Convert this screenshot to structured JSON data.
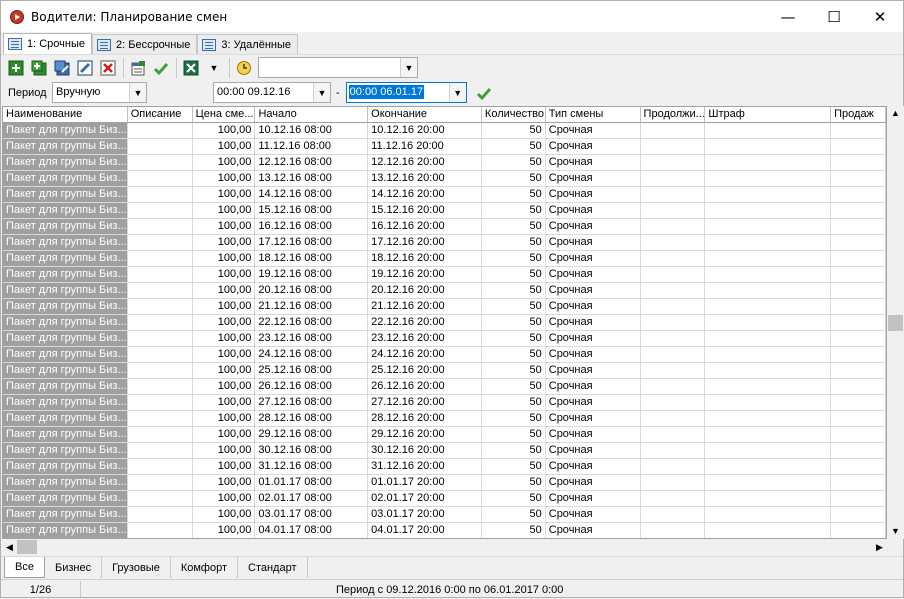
{
  "window": {
    "title": "Водители: Планирование смен",
    "minimize": "—",
    "maximize": "☐",
    "close": "✕"
  },
  "tabs": [
    {
      "label": "1: Срочные"
    },
    {
      "label": "2: Бессрочные"
    },
    {
      "label": "3: Удалённые"
    }
  ],
  "toolbar": {
    "combo_value": ""
  },
  "filter": {
    "period_label": "Период",
    "period_value": "Вручную",
    "date_from": "00:00 09.12.16",
    "dash": "-",
    "date_to": "00:00 06.01.17"
  },
  "grid": {
    "columns": [
      "Наименование",
      "Описание",
      "Цена сме...",
      "Начало",
      "Окончание",
      "Количество",
      "Тип смены",
      "Продолжи...",
      "Штраф",
      "Продаж"
    ],
    "rows": [
      [
        "Пакет для группы Биз...",
        "",
        "100,00",
        "10.12.16 08:00",
        "10.12.16 20:00",
        "50",
        "Срочная",
        "",
        "",
        ""
      ],
      [
        "Пакет для группы Биз...",
        "",
        "100,00",
        "11.12.16 08:00",
        "11.12.16 20:00",
        "50",
        "Срочная",
        "",
        "",
        ""
      ],
      [
        "Пакет для группы Биз...",
        "",
        "100,00",
        "12.12.16 08:00",
        "12.12.16 20:00",
        "50",
        "Срочная",
        "",
        "",
        ""
      ],
      [
        "Пакет для группы Биз...",
        "",
        "100,00",
        "13.12.16 08:00",
        "13.12.16 20:00",
        "50",
        "Срочная",
        "",
        "",
        ""
      ],
      [
        "Пакет для группы Биз...",
        "",
        "100,00",
        "14.12.16 08:00",
        "14.12.16 20:00",
        "50",
        "Срочная",
        "",
        "",
        ""
      ],
      [
        "Пакет для группы Биз...",
        "",
        "100,00",
        "15.12.16 08:00",
        "15.12.16 20:00",
        "50",
        "Срочная",
        "",
        "",
        ""
      ],
      [
        "Пакет для группы Биз...",
        "",
        "100,00",
        "16.12.16 08:00",
        "16.12.16 20:00",
        "50",
        "Срочная",
        "",
        "",
        ""
      ],
      [
        "Пакет для группы Биз...",
        "",
        "100,00",
        "17.12.16 08:00",
        "17.12.16 20:00",
        "50",
        "Срочная",
        "",
        "",
        ""
      ],
      [
        "Пакет для группы Биз...",
        "",
        "100,00",
        "18.12.16 08:00",
        "18.12.16 20:00",
        "50",
        "Срочная",
        "",
        "",
        ""
      ],
      [
        "Пакет для группы Биз...",
        "",
        "100,00",
        "19.12.16 08:00",
        "19.12.16 20:00",
        "50",
        "Срочная",
        "",
        "",
        ""
      ],
      [
        "Пакет для группы Биз...",
        "",
        "100,00",
        "20.12.16 08:00",
        "20.12.16 20:00",
        "50",
        "Срочная",
        "",
        "",
        ""
      ],
      [
        "Пакет для группы Биз...",
        "",
        "100,00",
        "21.12.16 08:00",
        "21.12.16 20:00",
        "50",
        "Срочная",
        "",
        "",
        ""
      ],
      [
        "Пакет для группы Биз...",
        "",
        "100,00",
        "22.12.16 08:00",
        "22.12.16 20:00",
        "50",
        "Срочная",
        "",
        "",
        ""
      ],
      [
        "Пакет для группы Биз...",
        "",
        "100,00",
        "23.12.16 08:00",
        "23.12.16 20:00",
        "50",
        "Срочная",
        "",
        "",
        ""
      ],
      [
        "Пакет для группы Биз...",
        "",
        "100,00",
        "24.12.16 08:00",
        "24.12.16 20:00",
        "50",
        "Срочная",
        "",
        "",
        ""
      ],
      [
        "Пакет для группы Биз...",
        "",
        "100,00",
        "25.12.16 08:00",
        "25.12.16 20:00",
        "50",
        "Срочная",
        "",
        "",
        ""
      ],
      [
        "Пакет для группы Биз...",
        "",
        "100,00",
        "26.12.16 08:00",
        "26.12.16 20:00",
        "50",
        "Срочная",
        "",
        "",
        ""
      ],
      [
        "Пакет для группы Биз...",
        "",
        "100,00",
        "27.12.16 08:00",
        "27.12.16 20:00",
        "50",
        "Срочная",
        "",
        "",
        ""
      ],
      [
        "Пакет для группы Биз...",
        "",
        "100,00",
        "28.12.16 08:00",
        "28.12.16 20:00",
        "50",
        "Срочная",
        "",
        "",
        ""
      ],
      [
        "Пакет для группы Биз...",
        "",
        "100,00",
        "29.12.16 08:00",
        "29.12.16 20:00",
        "50",
        "Срочная",
        "",
        "",
        ""
      ],
      [
        "Пакет для группы Биз...",
        "",
        "100,00",
        "30.12.16 08:00",
        "30.12.16 20:00",
        "50",
        "Срочная",
        "",
        "",
        ""
      ],
      [
        "Пакет для группы Биз...",
        "",
        "100,00",
        "31.12.16 08:00",
        "31.12.16 20:00",
        "50",
        "Срочная",
        "",
        "",
        ""
      ],
      [
        "Пакет для группы Биз...",
        "",
        "100,00",
        "01.01.17 08:00",
        "01.01.17 20:00",
        "50",
        "Срочная",
        "",
        "",
        ""
      ],
      [
        "Пакет для группы Биз...",
        "",
        "100,00",
        "02.01.17 08:00",
        "02.01.17 20:00",
        "50",
        "Срочная",
        "",
        "",
        ""
      ],
      [
        "Пакет для группы Биз...",
        "",
        "100,00",
        "03.01.17 08:00",
        "03.01.17 20:00",
        "50",
        "Срочная",
        "",
        "",
        ""
      ],
      [
        "Пакет для группы Биз...",
        "",
        "100,00",
        "04.01.17 08:00",
        "04.01.17 20:00",
        "50",
        "Срочная",
        "",
        "",
        ""
      ]
    ]
  },
  "bottom_tabs": [
    {
      "label": "Все"
    },
    {
      "label": "Бизнес"
    },
    {
      "label": "Грузовые"
    },
    {
      "label": "Комфорт"
    },
    {
      "label": "Стандарт"
    }
  ],
  "status": {
    "record": "1/26",
    "period_text": "Период с 09.12.2016 0:00 по 06.01.2017 0:00"
  },
  "colors": {
    "selected_cell": "#a0a0a0",
    "date_highlight": "#0078d7",
    "accept_green": "#3aa335"
  }
}
